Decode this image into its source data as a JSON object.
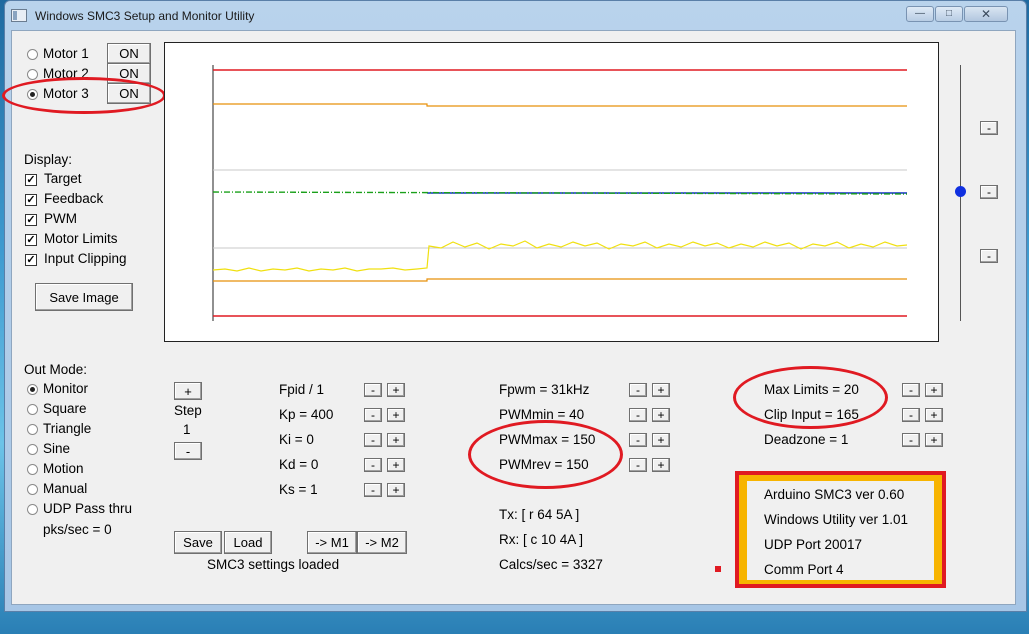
{
  "window": {
    "title": "Windows SMC3 Setup and Monitor Utility",
    "min_icon": "minimize-icon",
    "max_icon": "maximize-icon",
    "close_icon": "close-icon"
  },
  "motors": [
    {
      "label": "Motor 1",
      "state": "ON",
      "selected": false
    },
    {
      "label": "Motor 2",
      "state": "ON",
      "selected": false
    },
    {
      "label": "Motor 3",
      "state": "ON",
      "selected": true
    }
  ],
  "display": {
    "heading": "Display:",
    "options": [
      {
        "label": "Target",
        "checked": true
      },
      {
        "label": "Feedback",
        "checked": true
      },
      {
        "label": "PWM",
        "checked": true
      },
      {
        "label": "Motor Limits",
        "checked": true
      },
      {
        "label": "Input Clipping",
        "checked": true
      }
    ],
    "save_image": "Save Image"
  },
  "out_mode": {
    "heading": "Out Mode:",
    "options": [
      "Monitor",
      "Square",
      "Triangle",
      "Sine",
      "Motion",
      "Manual",
      "UDP Pass thru"
    ],
    "selected": "Monitor",
    "pks_label": "pks/sec = 0"
  },
  "step": {
    "plus": "+",
    "label": "Step",
    "value": "1",
    "minus": "-"
  },
  "pid": [
    "Fpid / 1",
    "Kp = 400",
    "Ki = 0",
    "Kd = 0",
    "Ks = 1"
  ],
  "pwm": [
    "Fpwm = 31kHz",
    "PWMmin = 40",
    "PWMmax = 150",
    "PWMrev = 150"
  ],
  "limits": [
    "Max Limits = 20",
    "Clip Input = 165",
    "Deadzone = 1"
  ],
  "comm": {
    "tx": "Tx: [ r 64 5A ]",
    "rx": "Rx: [ c 10 4A ]",
    "calcs": "Calcs/sec = 3327"
  },
  "info": [
    "Arduino SMC3 ver 0.60",
    "Windows Utility ver 1.01",
    "UDP Port 20017",
    "Comm Port 4"
  ],
  "buttons": {
    "save": "Save",
    "load": "Load",
    "to_m1": "-> M1",
    "to_m2": "-> M2",
    "status": "SMC3 settings loaded"
  },
  "adjust": {
    "minus": "-",
    "plus": "+"
  },
  "colors": {
    "limit_red": "#e01a22",
    "clip_orange": "#e8900a",
    "target_blue": "#1030c0",
    "feedback_green": "#1aa01a",
    "pwm_yellow": "#f0e010",
    "highlight_yellow": "#f7b400"
  }
}
